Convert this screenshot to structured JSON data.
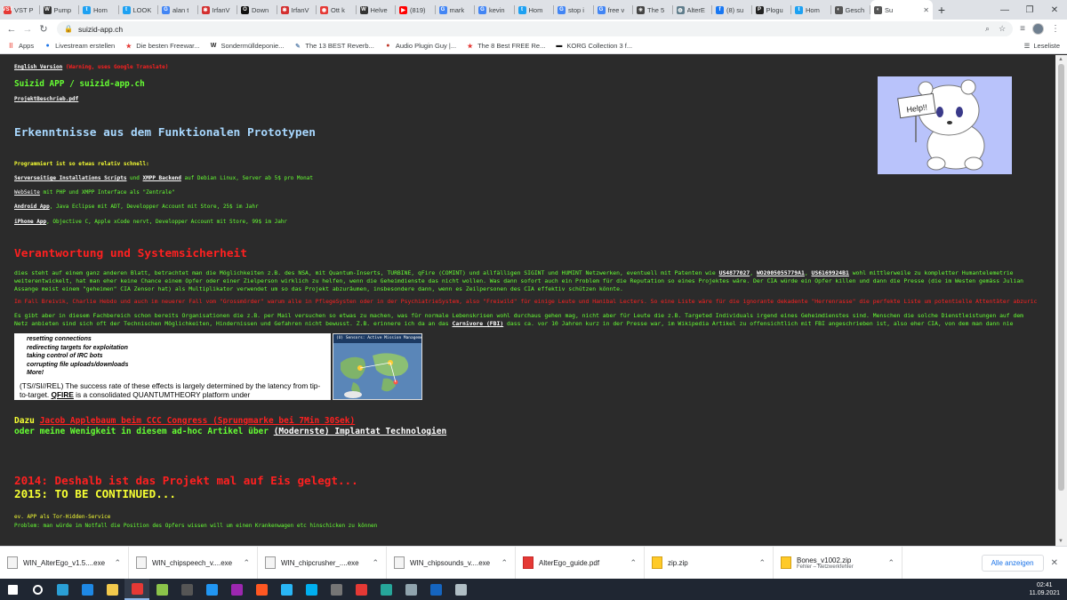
{
  "browser": {
    "tabs": [
      {
        "title": "VST P",
        "fav": "VST",
        "color": "#e53935"
      },
      {
        "title": "Pump",
        "fav": "W",
        "color": "#333333"
      },
      {
        "title": "Hom",
        "fav": "t",
        "color": "#1da1f2"
      },
      {
        "title": "LOOK",
        "fav": "t",
        "color": "#1da1f2"
      },
      {
        "title": "alan t",
        "fav": "G",
        "color": "#4285f4"
      },
      {
        "title": "IrfanV",
        "fav": "✱",
        "color": "#d32f2f"
      },
      {
        "title": "Down",
        "fav": "O",
        "color": "#111111"
      },
      {
        "title": "IrfanV",
        "fav": "✱",
        "color": "#d32f2f"
      },
      {
        "title": "Ott k",
        "fav": "◉",
        "color": "#e53935"
      },
      {
        "title": "Helve",
        "fav": "W",
        "color": "#333333"
      },
      {
        "title": "(819)",
        "fav": "▶",
        "color": "#ff0000"
      },
      {
        "title": "mark",
        "fav": "G",
        "color": "#4285f4"
      },
      {
        "title": "kevin",
        "fav": "G",
        "color": "#4285f4"
      },
      {
        "title": "Hom",
        "fav": "t",
        "color": "#1da1f2"
      },
      {
        "title": "stop i",
        "fav": "G",
        "color": "#4285f4"
      },
      {
        "title": "free v",
        "fav": "G",
        "color": "#4285f4"
      },
      {
        "title": "The 5",
        "fav": "✳",
        "color": "#444444"
      },
      {
        "title": "AlterE",
        "fav": "◍",
        "color": "#607d8b"
      },
      {
        "title": "(8) su",
        "fav": "f",
        "color": "#1877f2"
      },
      {
        "title": "Plogu",
        "fav": "P",
        "color": "#222222"
      },
      {
        "title": "Hom",
        "fav": "t",
        "color": "#1da1f2"
      },
      {
        "title": "Gesch",
        "fav": "◐",
        "color": "#555555"
      }
    ],
    "active_tab": {
      "title": "Su",
      "fav": "◐",
      "color": "#555555",
      "close": "✕"
    },
    "new_tab": "+",
    "window_controls": {
      "minimize": "—",
      "maximize": "❐",
      "close": "✕"
    },
    "url": "suizid-app.ch",
    "bookmarks": [
      {
        "label": "Apps",
        "icon": "grid-icon"
      },
      {
        "label": "Livestream erstellen",
        "icon": "circle-icon"
      },
      {
        "label": "Die besten Freewar...",
        "icon": "star-icon"
      },
      {
        "label": "Sondermülldeponie...",
        "icon": "w-icon"
      },
      {
        "label": "The 13 BEST Reverb...",
        "icon": "pen-icon"
      },
      {
        "label": "Audio Plugin Guy |...",
        "icon": "guy-icon"
      },
      {
        "label": "The 8 Best FREE Re...",
        "icon": "star-icon"
      },
      {
        "label": "KORG Collection 3 f...",
        "icon": "korg-icon"
      }
    ],
    "reading_list": "Leseliste"
  },
  "page": {
    "english_version": "English Version",
    "english_warning": "(Warning, uses Google Translate)",
    "site_title": "Suizid APP / suizid-app.ch",
    "project_pdf": "ProjektBeschrieb.pdf",
    "heading1": "Erkenntnisse aus dem Funktionalen Prototypen",
    "programmiert": "Programmiert ist so etwas relativ schnell:",
    "line1_a": "Serverseitige Installations Scripts",
    "line1_b": " und ",
    "line1_c": "XMPP Backend",
    "line1_d": " auf Debian Linux, Server ab 5$ pro Monat",
    "line2_a": "WebSeite",
    "line2_b": " mit PHP und XMPP Interface als \"Zentrale\"",
    "line3_a": "Android App",
    "line3_b": ", Java Eclipse mit ADT, Developper Account mit Store, 25$ im Jahr",
    "line4_a": "iPhone App",
    "line4_b": ", Objective C, Apple xCode nervt, Developper Account mit Store, 99$ im Jahr",
    "heading2": "Verantwortung und Systemsicherheit",
    "para1_a": "dies steht auf einem ganz anderen Blatt, betrachtet man die Möglichkeiten z.B. des NSA, mit Quantum-Inserts, TURBINE, qFire (COMINT) und allfälligen SIGINT und HUMINT Netzwerken, eventuell mit Patenten wie ",
    "patent1": "US4877027",
    "sep1": ", ",
    "patent2": "WO2005055779A1",
    "sep2": ", ",
    "patent3": "US6169924B1",
    "para1_b": " wohl mittlerweile zu kompletter Humantelemetrie weiterentwickelt, hat man eher keine Chance einem Opfer oder einer Zielperson wirklich zu helfen, wenn die Geheimdienste das nicht wollen. Was dann sofort auch ein Problem für die Reputation so eines Projektes wäre. Der CIA würde ein Opfer killen und dann die Presse (die im Westen gemäss Julian Assange meist einem \"geheimen\" CIA Zensor hat) als Multiplikator verwendet um so das Projekt abzuräumen, insbesondere dann, wenn es Zeilpersonen des CIA effektiv schützen könnte.",
    "para2": "Im Fall Breivik, Charlie Hebdo und auch im neuerer Fall vom \"Grossmörder\" warum alle in PflegeSysten oder in der PsychiatrieSystem, also \"Freiwild\" für einige Leute und Hanibal Lecters. So eine Liste wäre für die ignorante dekadente \"Herrenrasse\" die perfekte Liste um potentielle Attentäter abzurichten.",
    "para3_a": "Es gibt aber in diesem Fachbereich schon bereits Organisationen die z.B. per Mail versuchen so etwas zu machen, was für normale Lebenskrisen wohl durchaus gehen mag, nicht aber für Leute die z.B. Targeted Individuals irgend eines Geheimdienstes sind. Menschen die solche Dienstleistungen auf dem Netz anbieten sind sich oft der Technischen Möglichkeiten, Hindernissen und Gefahren nicht bewusst. Z.B. erinnere ich da an das ",
    "carnivore": "Carnivore (FBI)",
    "para3_b": " dass ca. vor 10 Jahren kurz in der Presse war, im Wikipedia Artikel zu offensichtlich mit FBI angeschrieben ist, also eher CIA, von dem man dann nie wieder was gehört hat...",
    "slide_bullets": [
      "resetting connections",
      "redirecting targets for exploitation",
      "taking control of IRC bots",
      "corrupting file uploads/downloads",
      "More!"
    ],
    "slide_footer_a": "(TS//SI//REL) The success rate of these effects is largely determined by the latency from tip-to-target. ",
    "slide_footer_b": "QFIRE",
    "slide_footer_c": " is a consolidated QUANTUMTHEORY platform under",
    "map_title": "(U) Sensors: Active Mission Management",
    "dazu": "Dazu ",
    "jacob_link": "Jacob Applebaum beim CCC Congress (Sprungmarke bei 7Min 30Sek)",
    "oder": "oder meine Wenigkeit in diesem ad-hoc Artikel über ",
    "implant_link": "(Modernste) Implantat Technologien",
    "big_red": "2014: Deshalb ist das Projekt mal auf Eis gelegt...",
    "big_yellow": "2015: TO BE CONTINUED...",
    "small1": "ev. APP als Tor-Hidden-Service",
    "small2": "Problem: man würde im Notfall die Position des Opfers wissen will um einen Krankenwagen etc hinschicken zu können",
    "bear_sign": "Help!!"
  },
  "downloads": [
    {
      "name": "WIN_AlterEgo_v1.5....exe",
      "type": "exe"
    },
    {
      "name": "WIN_chipspeech_v....exe",
      "type": "exe"
    },
    {
      "name": "WIN_chipcrusher_....exe",
      "type": "exe"
    },
    {
      "name": "WIN_chipsounds_v....exe",
      "type": "exe"
    },
    {
      "name": "AlterEgo_guide.pdf",
      "type": "pdf"
    },
    {
      "name": "zip.zip",
      "type": "zip"
    },
    {
      "name": "Bones_v1002.zip",
      "type": "zip",
      "sub": "Fehler – Netzwerkfehler"
    }
  ],
  "show_all": "Alle anzeigen",
  "clock": {
    "time": "02:41",
    "date": "11.09.2021"
  }
}
